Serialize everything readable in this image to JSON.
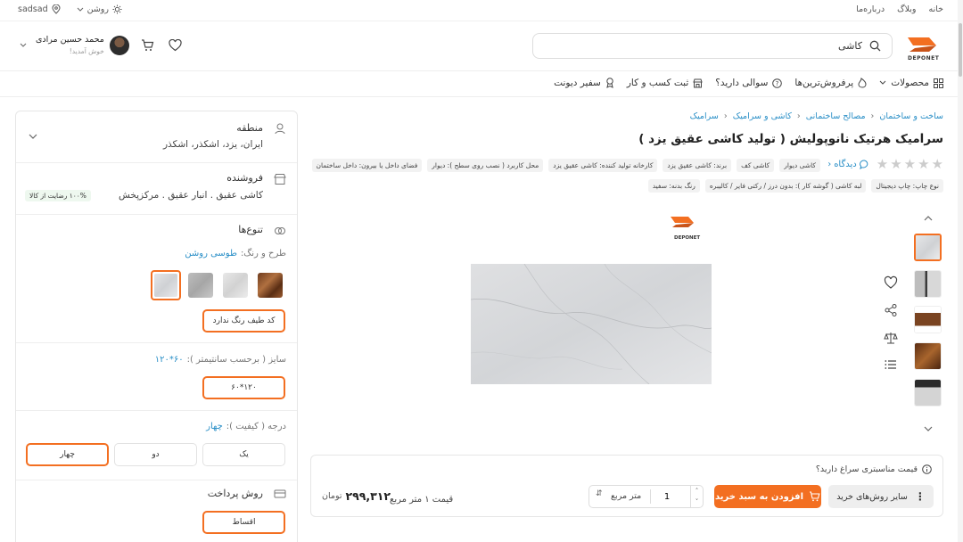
{
  "topbar": {
    "links": [
      "خانه",
      "وبلاگ",
      "درباره‌ما"
    ],
    "theme_label": "روشن",
    "location_label": "sadsad"
  },
  "header": {
    "logo_text": "DEPONET",
    "search_value": "کاشی",
    "user_name": "محمد حسین مرادی",
    "user_greeting": "خوش آمدید!"
  },
  "nav": {
    "items": [
      "محصولات",
      "پرفروش‌ترین‌ها",
      "سوالی دارید؟",
      "ثبت کسب و کار",
      "سفیر دیونت"
    ]
  },
  "breadcrumb": [
    "ساخت و ساختمان",
    "مصالح ساختمانی",
    "کاشی و سرامیک",
    "سرامیک"
  ],
  "product": {
    "title": "سرامیک هرتیک نانوپولیش ( تولید کاشی عقیق یزد )",
    "rating": 0,
    "reviews_link": "دیدگاه",
    "chips_row1": [
      "کاشی دیوار",
      "کاشی کف",
      "برند: کاشی عقیق یزد",
      "کارخانه تولید کننده: کاشی عقیق یزد",
      "محل کاربرد ( نصب روی سطح ): دیوار",
      "فضای داخل یا بیرون: داخل ساختمان"
    ],
    "chips_row2": [
      "نوع چاپ: چاپ دیجیتال",
      "لبه کاشی ( گوشه کار ): بدون درز / رکتی فایر / کالیبره",
      "رنگ بدنه: سفید"
    ],
    "image_logo": "DEPONET"
  },
  "sidebar": {
    "region": {
      "title": "منطقه",
      "value": "ایران، یزد، اشکذر، اشکذر"
    },
    "seller": {
      "title": "فروشنده",
      "value": "کاشی عقیق . انبار عقیق . مرکزپخش",
      "satisfaction": "۱۰۰% رضایت از کالا"
    },
    "variants": {
      "title": "تنوع‌ها",
      "color_label": "طرح و رنگ:",
      "color_value": "طوسی روشن",
      "color_code_button": "کد طیف رنگ ندارد",
      "size_label": "سایز ( برحسب سانتیمتر ):",
      "size_value": "۶۰*۱۲۰",
      "size_option": "۶۰*۱۲۰",
      "grade_label": "درجه ( کیفیت ):",
      "grade_value": "چهار",
      "grade_options": [
        "یک",
        "دو",
        "چهار"
      ]
    },
    "payment": {
      "title": "روش پرداخت",
      "option": "اقساط"
    }
  },
  "buybox": {
    "suitable_question": "قیمت مناسبتری سراغ دارید؟",
    "other_ways": "سایر روش‌های خرید",
    "add_to_cart": "افزودن به سبد خرید",
    "quantity": "1",
    "unit": "متر مربع",
    "price_label": "قیمت ۱ متر مربع",
    "price": "۲۹۹,۳۱۲",
    "currency": "تومان"
  },
  "colors": {
    "accent": "#f36f21",
    "link": "#2a8fc7"
  },
  "icons": [
    "search-icon",
    "cart-icon",
    "heart-icon",
    "location-icon",
    "sun-icon",
    "share-icon",
    "compare-icon",
    "list-icon",
    "info-icon"
  ]
}
